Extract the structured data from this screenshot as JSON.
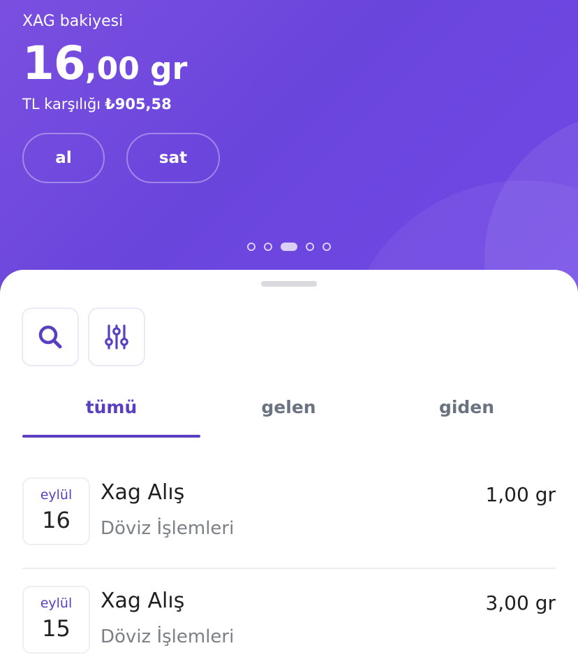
{
  "balance": {
    "label": "XAG bakiyesi",
    "amount_int": "16",
    "amount_dec": ",00 gr",
    "tl_label": "TL karşılığı",
    "tl_value": "₺905,58"
  },
  "actions": {
    "buy_label": "al",
    "sell_label": "sat"
  },
  "carousel": {
    "pages": 5,
    "active_index": 2
  },
  "toolbar": {
    "search_icon": "search-icon",
    "filter_icon": "sliders-icon"
  },
  "tabs": [
    {
      "label": "tümü",
      "active": true
    },
    {
      "label": "gelen",
      "active": false
    },
    {
      "label": "giden",
      "active": false
    }
  ],
  "transactions": [
    {
      "month": "eylül",
      "day": "16",
      "title": "Xag Alış",
      "subtitle": "Döviz İşlemleri",
      "amount": "1,00 gr"
    },
    {
      "month": "eylül",
      "day": "15",
      "title": "Xag Alış",
      "subtitle": "Döviz İşlemleri",
      "amount": "3,00 gr"
    }
  ],
  "colors": {
    "accent": "#5a3fc0",
    "hero": "#6d47de"
  }
}
